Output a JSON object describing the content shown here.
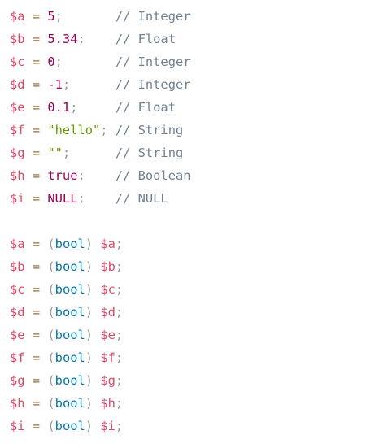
{
  "colors": {
    "variable": "#dd4a68",
    "operator": "#9a6e3a",
    "number": "#990055",
    "comment": "#708090",
    "string": "#669900",
    "keyword": "#0077aa",
    "punctuation": "#999999"
  },
  "lines": [
    {
      "tokens": [
        {
          "t": "variable",
          "text": "$a"
        },
        {
          "t": "plain",
          "text": " "
        },
        {
          "t": "operator",
          "text": "="
        },
        {
          "t": "plain",
          "text": " "
        },
        {
          "t": "number",
          "text": "5"
        },
        {
          "t": "punctuation",
          "text": ";"
        },
        {
          "t": "plain",
          "text": "       "
        },
        {
          "t": "comment",
          "text": "// Integer"
        }
      ]
    },
    {
      "tokens": [
        {
          "t": "variable",
          "text": "$b"
        },
        {
          "t": "plain",
          "text": " "
        },
        {
          "t": "operator",
          "text": "="
        },
        {
          "t": "plain",
          "text": " "
        },
        {
          "t": "number",
          "text": "5.34"
        },
        {
          "t": "punctuation",
          "text": ";"
        },
        {
          "t": "plain",
          "text": "    "
        },
        {
          "t": "comment",
          "text": "// Float"
        }
      ]
    },
    {
      "tokens": [
        {
          "t": "variable",
          "text": "$c"
        },
        {
          "t": "plain",
          "text": " "
        },
        {
          "t": "operator",
          "text": "="
        },
        {
          "t": "plain",
          "text": " "
        },
        {
          "t": "number",
          "text": "0"
        },
        {
          "t": "punctuation",
          "text": ";"
        },
        {
          "t": "plain",
          "text": "       "
        },
        {
          "t": "comment",
          "text": "// Integer"
        }
      ]
    },
    {
      "tokens": [
        {
          "t": "variable",
          "text": "$d"
        },
        {
          "t": "plain",
          "text": " "
        },
        {
          "t": "operator",
          "text": "="
        },
        {
          "t": "plain",
          "text": " "
        },
        {
          "t": "number",
          "text": "-1"
        },
        {
          "t": "punctuation",
          "text": ";"
        },
        {
          "t": "plain",
          "text": "      "
        },
        {
          "t": "comment",
          "text": "// Integer"
        }
      ]
    },
    {
      "tokens": [
        {
          "t": "variable",
          "text": "$e"
        },
        {
          "t": "plain",
          "text": " "
        },
        {
          "t": "operator",
          "text": "="
        },
        {
          "t": "plain",
          "text": " "
        },
        {
          "t": "number",
          "text": "0.1"
        },
        {
          "t": "punctuation",
          "text": ";"
        },
        {
          "t": "plain",
          "text": "     "
        },
        {
          "t": "comment",
          "text": "// Float"
        }
      ]
    },
    {
      "tokens": [
        {
          "t": "variable",
          "text": "$f"
        },
        {
          "t": "plain",
          "text": " "
        },
        {
          "t": "operator",
          "text": "="
        },
        {
          "t": "plain",
          "text": " "
        },
        {
          "t": "string",
          "text": "\"hello\""
        },
        {
          "t": "punctuation",
          "text": ";"
        },
        {
          "t": "plain",
          "text": " "
        },
        {
          "t": "comment",
          "text": "// String"
        }
      ]
    },
    {
      "tokens": [
        {
          "t": "variable",
          "text": "$g"
        },
        {
          "t": "plain",
          "text": " "
        },
        {
          "t": "operator",
          "text": "="
        },
        {
          "t": "plain",
          "text": " "
        },
        {
          "t": "string",
          "text": "\"\""
        },
        {
          "t": "punctuation",
          "text": ";"
        },
        {
          "t": "plain",
          "text": "      "
        },
        {
          "t": "comment",
          "text": "// String"
        }
      ]
    },
    {
      "tokens": [
        {
          "t": "variable",
          "text": "$h"
        },
        {
          "t": "plain",
          "text": " "
        },
        {
          "t": "operator",
          "text": "="
        },
        {
          "t": "plain",
          "text": " "
        },
        {
          "t": "boolean",
          "text": "true"
        },
        {
          "t": "punctuation",
          "text": ";"
        },
        {
          "t": "plain",
          "text": "    "
        },
        {
          "t": "comment",
          "text": "// Boolean"
        }
      ]
    },
    {
      "tokens": [
        {
          "t": "variable",
          "text": "$i"
        },
        {
          "t": "plain",
          "text": " "
        },
        {
          "t": "operator",
          "text": "="
        },
        {
          "t": "plain",
          "text": " "
        },
        {
          "t": "constant",
          "text": "NULL"
        },
        {
          "t": "punctuation",
          "text": ";"
        },
        {
          "t": "plain",
          "text": "    "
        },
        {
          "t": "comment",
          "text": "// NULL"
        }
      ]
    },
    {
      "tokens": []
    },
    {
      "tokens": [
        {
          "t": "variable",
          "text": "$a"
        },
        {
          "t": "plain",
          "text": " "
        },
        {
          "t": "operator",
          "text": "="
        },
        {
          "t": "plain",
          "text": " "
        },
        {
          "t": "punctuation",
          "text": "("
        },
        {
          "t": "keyword",
          "text": "bool"
        },
        {
          "t": "punctuation",
          "text": ")"
        },
        {
          "t": "plain",
          "text": " "
        },
        {
          "t": "variable",
          "text": "$a"
        },
        {
          "t": "punctuation",
          "text": ";"
        }
      ]
    },
    {
      "tokens": [
        {
          "t": "variable",
          "text": "$b"
        },
        {
          "t": "plain",
          "text": " "
        },
        {
          "t": "operator",
          "text": "="
        },
        {
          "t": "plain",
          "text": " "
        },
        {
          "t": "punctuation",
          "text": "("
        },
        {
          "t": "keyword",
          "text": "bool"
        },
        {
          "t": "punctuation",
          "text": ")"
        },
        {
          "t": "plain",
          "text": " "
        },
        {
          "t": "variable",
          "text": "$b"
        },
        {
          "t": "punctuation",
          "text": ";"
        }
      ]
    },
    {
      "tokens": [
        {
          "t": "variable",
          "text": "$c"
        },
        {
          "t": "plain",
          "text": " "
        },
        {
          "t": "operator",
          "text": "="
        },
        {
          "t": "plain",
          "text": " "
        },
        {
          "t": "punctuation",
          "text": "("
        },
        {
          "t": "keyword",
          "text": "bool"
        },
        {
          "t": "punctuation",
          "text": ")"
        },
        {
          "t": "plain",
          "text": " "
        },
        {
          "t": "variable",
          "text": "$c"
        },
        {
          "t": "punctuation",
          "text": ";"
        }
      ]
    },
    {
      "tokens": [
        {
          "t": "variable",
          "text": "$d"
        },
        {
          "t": "plain",
          "text": " "
        },
        {
          "t": "operator",
          "text": "="
        },
        {
          "t": "plain",
          "text": " "
        },
        {
          "t": "punctuation",
          "text": "("
        },
        {
          "t": "keyword",
          "text": "bool"
        },
        {
          "t": "punctuation",
          "text": ")"
        },
        {
          "t": "plain",
          "text": " "
        },
        {
          "t": "variable",
          "text": "$d"
        },
        {
          "t": "punctuation",
          "text": ";"
        }
      ]
    },
    {
      "tokens": [
        {
          "t": "variable",
          "text": "$e"
        },
        {
          "t": "plain",
          "text": " "
        },
        {
          "t": "operator",
          "text": "="
        },
        {
          "t": "plain",
          "text": " "
        },
        {
          "t": "punctuation",
          "text": "("
        },
        {
          "t": "keyword",
          "text": "bool"
        },
        {
          "t": "punctuation",
          "text": ")"
        },
        {
          "t": "plain",
          "text": " "
        },
        {
          "t": "variable",
          "text": "$e"
        },
        {
          "t": "punctuation",
          "text": ";"
        }
      ]
    },
    {
      "tokens": [
        {
          "t": "variable",
          "text": "$f"
        },
        {
          "t": "plain",
          "text": " "
        },
        {
          "t": "operator",
          "text": "="
        },
        {
          "t": "plain",
          "text": " "
        },
        {
          "t": "punctuation",
          "text": "("
        },
        {
          "t": "keyword",
          "text": "bool"
        },
        {
          "t": "punctuation",
          "text": ")"
        },
        {
          "t": "plain",
          "text": " "
        },
        {
          "t": "variable",
          "text": "$f"
        },
        {
          "t": "punctuation",
          "text": ";"
        }
      ]
    },
    {
      "tokens": [
        {
          "t": "variable",
          "text": "$g"
        },
        {
          "t": "plain",
          "text": " "
        },
        {
          "t": "operator",
          "text": "="
        },
        {
          "t": "plain",
          "text": " "
        },
        {
          "t": "punctuation",
          "text": "("
        },
        {
          "t": "keyword",
          "text": "bool"
        },
        {
          "t": "punctuation",
          "text": ")"
        },
        {
          "t": "plain",
          "text": " "
        },
        {
          "t": "variable",
          "text": "$g"
        },
        {
          "t": "punctuation",
          "text": ";"
        }
      ]
    },
    {
      "tokens": [
        {
          "t": "variable",
          "text": "$h"
        },
        {
          "t": "plain",
          "text": " "
        },
        {
          "t": "operator",
          "text": "="
        },
        {
          "t": "plain",
          "text": " "
        },
        {
          "t": "punctuation",
          "text": "("
        },
        {
          "t": "keyword",
          "text": "bool"
        },
        {
          "t": "punctuation",
          "text": ")"
        },
        {
          "t": "plain",
          "text": " "
        },
        {
          "t": "variable",
          "text": "$h"
        },
        {
          "t": "punctuation",
          "text": ";"
        }
      ]
    },
    {
      "tokens": [
        {
          "t": "variable",
          "text": "$i"
        },
        {
          "t": "plain",
          "text": " "
        },
        {
          "t": "operator",
          "text": "="
        },
        {
          "t": "plain",
          "text": " "
        },
        {
          "t": "punctuation",
          "text": "("
        },
        {
          "t": "keyword",
          "text": "bool"
        },
        {
          "t": "punctuation",
          "text": ")"
        },
        {
          "t": "plain",
          "text": " "
        },
        {
          "t": "variable",
          "text": "$i"
        },
        {
          "t": "punctuation",
          "text": ";"
        }
      ]
    }
  ]
}
